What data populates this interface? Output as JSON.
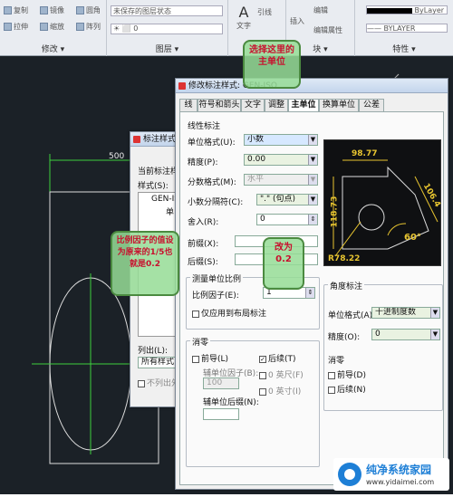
{
  "ribbon": {
    "modify_label": "修改 ▾",
    "layer_label": "图层 ▾",
    "block_label": "块 ▾",
    "properties_label": "特性 ▾",
    "items": [
      "复制",
      "镜像",
      "圆角",
      "拉伸",
      "缩放",
      "阵列"
    ],
    "layer_state": "未保存的图层状态",
    "text_btn": "文字",
    "dim_btn": "引线",
    "insert_btn": "插入",
    "edit_btn": "编辑",
    "attr_btn": "编辑属性",
    "bylayer1": "ByLayer",
    "bylayer2": "BYLAYER",
    "layer_zero": "0"
  },
  "cad": {
    "dim_text": "500"
  },
  "dimstyle_manager": {
    "title": "标注样式管理",
    "current_style": "当前标注样式:",
    "styles_label": "样式(S):",
    "style_item": "GEN-ISO",
    "unit_frag": "单",
    "list_label": "列出(L):",
    "list_value": "所有样式",
    "no_list": "不列出外"
  },
  "modify_dialog": {
    "title": "修改标注样式: GEN-ISO",
    "tabs": [
      "线",
      "符号和箭头",
      "文字",
      "调整",
      "主单位",
      "换算单位",
      "公差"
    ],
    "linear": {
      "legend": "线性标注",
      "unit_format_label": "单位格式(U):",
      "unit_format_value": "小数",
      "precision_label": "精度(P):",
      "precision_value": "0.00",
      "fraction_label": "分数格式(M):",
      "fraction_value": "水平",
      "decimal_sep_label": "小数分隔符(C):",
      "decimal_sep_value": "\".\" (句点)",
      "round_label": "舍入(R):",
      "round_value": "0",
      "prefix_label": "前缀(X):",
      "suffix_label": "后缀(S):"
    },
    "scale": {
      "legend": "测量单位比例",
      "factor_label": "比例因子(E):",
      "factor_value": "1",
      "layout_only_label": "仅应用到布局标注"
    },
    "zero_suppress": {
      "legend": "消零",
      "leading_label": "前导(L)",
      "trailing_label": "后续(T)",
      "sub_factor_label": "辅单位因子(B):",
      "sub_factor_value": "100",
      "sub_suffix_label": "辅单位后缀(N):",
      "feet_label": "0 英尺(F)",
      "inch_label": "0 英寸(I)"
    },
    "angular": {
      "legend": "角度标注",
      "unit_format_label": "单位格式(A):",
      "unit_format_value": "十进制度数",
      "precision_label": "精度(O):",
      "precision_value": "0",
      "zero_legend": "消零",
      "leading_label": "前导(D)",
      "trailing_label": "后续(N)"
    },
    "preview_labels": {
      "top": "98.77",
      "left": "118.73",
      "right": "106.4",
      "angle": "60°",
      "radius": "R78.22"
    }
  },
  "annotations": {
    "note1": "选择这里的主单位",
    "note2": "比例因子的值设为原来的1/5也就是0.2",
    "note3": "改为0.2"
  },
  "watermark": {
    "line1": "纯净系统家园",
    "line2": "www.yidaimei.com"
  }
}
